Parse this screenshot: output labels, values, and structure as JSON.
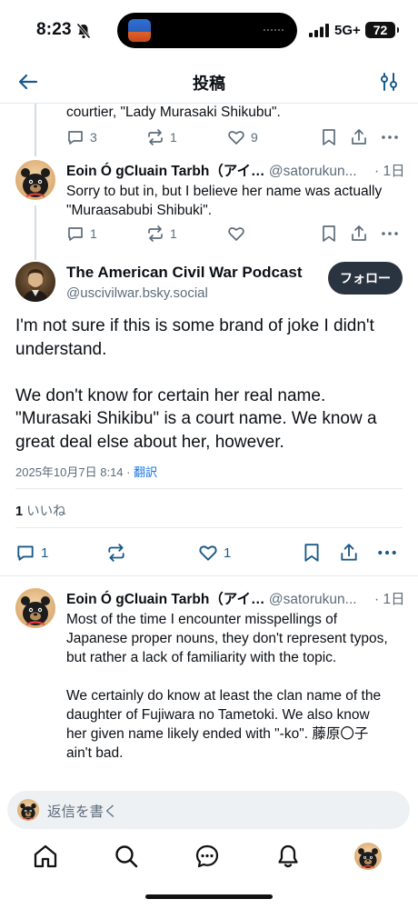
{
  "status_bar": {
    "time": "8:23",
    "network": "5G+",
    "battery": "72"
  },
  "header": {
    "title": "投稿"
  },
  "thread": {
    "prev_post": {
      "text_tail": "courtier, \"Lady Murasaki Shikubu\".",
      "reply_count": "3",
      "repost_count": "1",
      "like_count": "9"
    },
    "reply1": {
      "name": "Eoin Ó gCluain Tarbh（アイ…",
      "handle": "@satorukun...",
      "time": "· 1日",
      "text": "Sorry to but in, but I believe her name was actually \"Muraasabubi Shibuki\".",
      "reply_count": "1",
      "repost_count": "1"
    }
  },
  "main_post": {
    "author_name": "The American Civil War Podcast",
    "author_handle": "@uscivilwar.bsky.social",
    "follow_label": "フォロー",
    "body": "I'm not sure if this is some brand of joke I didn't understand.\n\nWe don't know for certain her real name. \"Murasaki Shikibu\" is a court name. We know a great deal else about her, however.",
    "timestamp": "2025年10月7日 8:14",
    "translate_label": "翻訳",
    "likes_count": "1",
    "likes_label": "いいね",
    "reply_count": "1",
    "like_count": "1"
  },
  "reply2": {
    "name": "Eoin Ó gCluain Tarbh（アイ…",
    "handle": "@satorukun...",
    "time": "· 1日",
    "text": "Most of the time I encounter misspellings of Japanese proper nouns, they don't represent typos, but rather a lack of familiarity with the topic.\n\nWe certainly do know at least the clan name of the daughter of Fujiwara no Tametoki. We also know her given name likely ended with \"-ko\". 藤原〇子 ain't bad."
  },
  "composer": {
    "placeholder": "返信を書く"
  },
  "tabs": [
    "home-icon",
    "search-icon",
    "chat-icon",
    "notifications-icon",
    "profile-avatar"
  ],
  "colors": {
    "muted": "#5d6c7a",
    "link": "#1a73e8",
    "follow_bg": "#2a3440",
    "divider": "#e6e9ed"
  }
}
